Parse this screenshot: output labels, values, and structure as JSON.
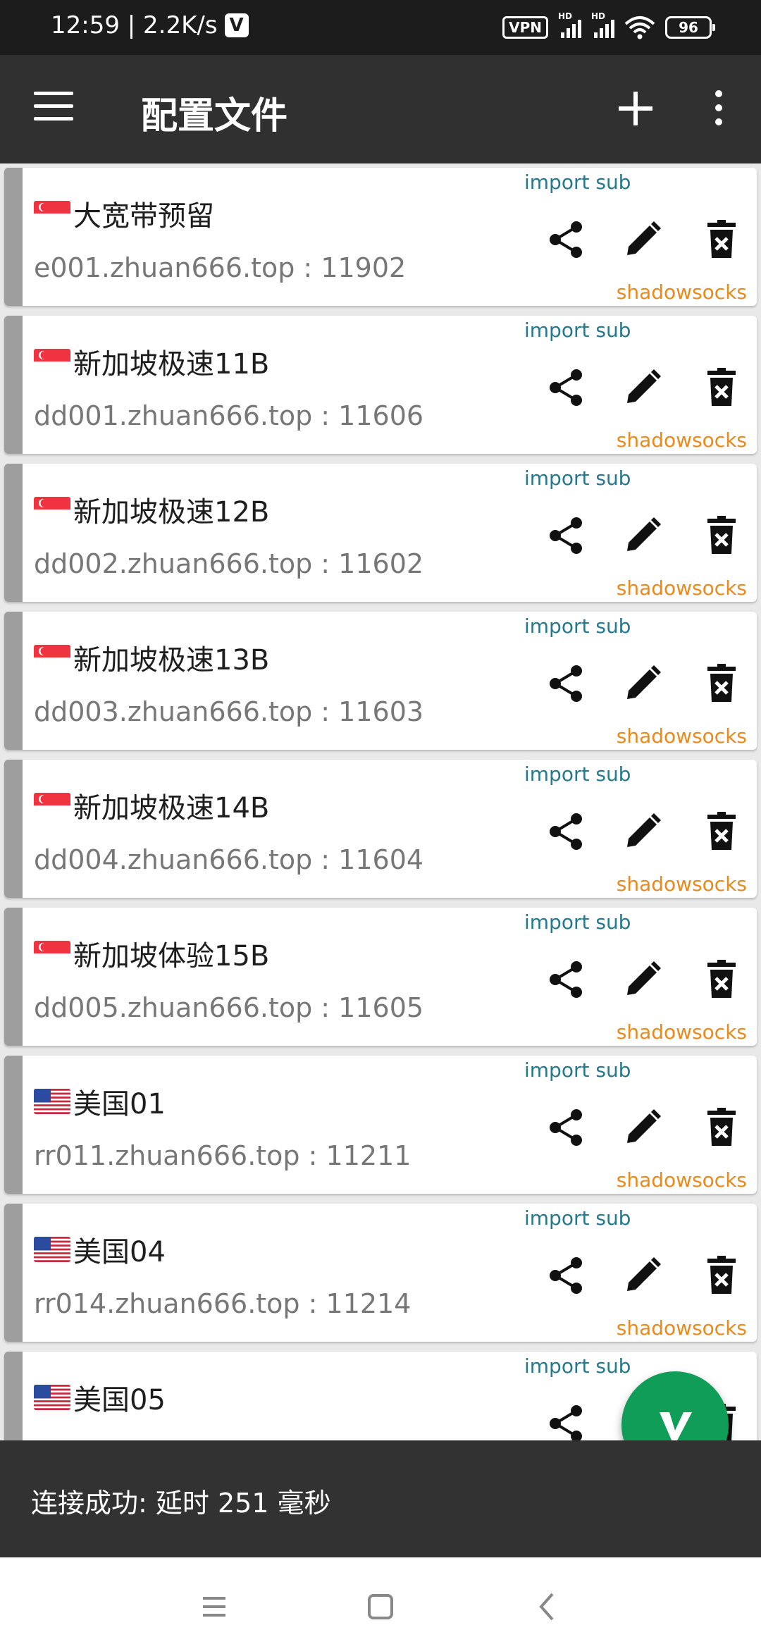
{
  "status_bar": {
    "time_speed": "12:59 | 2.2K/s",
    "vpn": "VPN",
    "hd": "HD",
    "battery": "96"
  },
  "app_bar": {
    "title": "配置文件"
  },
  "servers": [
    {
      "flag": "sg",
      "name": "大宽带预留",
      "address": "e001.zhuan666.top : 11902",
      "source": "import sub",
      "type": "shadowsocks"
    },
    {
      "flag": "sg",
      "name": "新加坡极速11B",
      "address": "dd001.zhuan666.top : 11606",
      "source": "import sub",
      "type": "shadowsocks"
    },
    {
      "flag": "sg",
      "name": "新加坡极速12B",
      "address": "dd002.zhuan666.top : 11602",
      "source": "import sub",
      "type": "shadowsocks"
    },
    {
      "flag": "sg",
      "name": "新加坡极速13B",
      "address": "dd003.zhuan666.top : 11603",
      "source": "import sub",
      "type": "shadowsocks"
    },
    {
      "flag": "sg",
      "name": "新加坡极速14B",
      "address": "dd004.zhuan666.top : 11604",
      "source": "import sub",
      "type": "shadowsocks"
    },
    {
      "flag": "sg",
      "name": "新加坡体验15B",
      "address": "dd005.zhuan666.top : 11605",
      "source": "import sub",
      "type": "shadowsocks"
    },
    {
      "flag": "us",
      "name": "美国01",
      "address": "rr011.zhuan666.top : 11211",
      "source": "import sub",
      "type": "shadowsocks"
    },
    {
      "flag": "us",
      "name": "美国04",
      "address": "rr014.zhuan666.top : 11214",
      "source": "import sub",
      "type": "shadowsocks"
    },
    {
      "flag": "us",
      "name": "美国05",
      "address": "",
      "source": "import sub",
      "type": ""
    }
  ],
  "snackbar": {
    "message": "连接成功: 延时 251 毫秒"
  },
  "fab": {
    "glyph": "V",
    "color": "#0f9d58"
  },
  "colors": {
    "app_bar": "#303030",
    "status_bar": "#1c1c1c",
    "source_text": "#26788c",
    "type_text": "#ea8a1c",
    "card_strip": "#9e9e9e"
  }
}
